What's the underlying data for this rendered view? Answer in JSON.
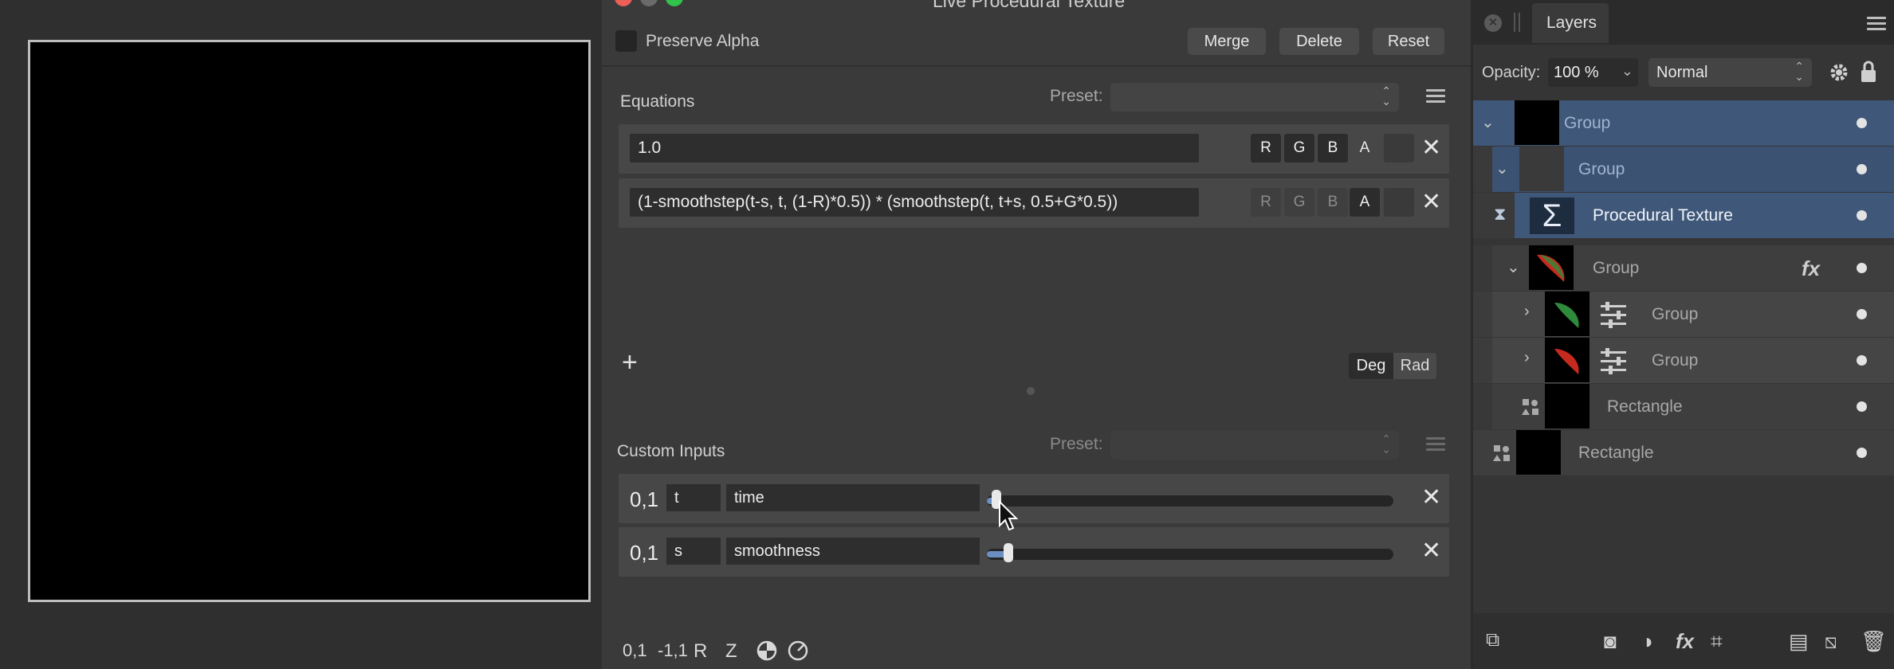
{
  "dialog": {
    "title": "Live Procedural Texture",
    "preserve_alpha_label": "Preserve Alpha",
    "merge_label": "Merge",
    "delete_label": "Delete",
    "reset_label": "Reset",
    "equations_label": "Equations",
    "preset_label": "Preset:",
    "equations": [
      {
        "expr": "1.0",
        "channels": [
          "R",
          "G",
          "B",
          "A"
        ],
        "active": [
          "R",
          "G",
          "B"
        ]
      },
      {
        "expr": "(1-smoothstep(t-s, t, (1-R)*0.5)) * (smoothstep(t, t+s, 0.5+G*0.5))",
        "channels": [
          "R",
          "G",
          "B",
          "A"
        ],
        "active": [
          "A"
        ]
      }
    ],
    "add_label": "+",
    "deg_label": "Deg",
    "rad_label": "Rad",
    "custom_inputs_label": "Custom Inputs",
    "inputs": [
      {
        "range": "0,1",
        "var": "t",
        "name": "time",
        "value": 0.0
      },
      {
        "range": "0,1",
        "var": "s",
        "name": "smoothness",
        "value": 0.03
      }
    ],
    "bottom_tools": [
      "0,1",
      "-1,1",
      "R",
      "Z"
    ]
  },
  "layers_panel": {
    "tab_label": "Layers",
    "opacity_label": "Opacity:",
    "opacity_value": "100 %",
    "blend_mode": "Normal",
    "layers": [
      {
        "name": "Group"
      },
      {
        "name": "Group"
      },
      {
        "name": "Procedural Texture"
      },
      {
        "name": "Group"
      },
      {
        "name": "Group"
      },
      {
        "name": "Group"
      },
      {
        "name": "Rectangle"
      },
      {
        "name": "Rectangle"
      }
    ]
  },
  "colors": {
    "selection": "#3f5778",
    "close": "#ec5f58",
    "minimize": "#6a6a6a",
    "maximize": "#31c34a"
  }
}
